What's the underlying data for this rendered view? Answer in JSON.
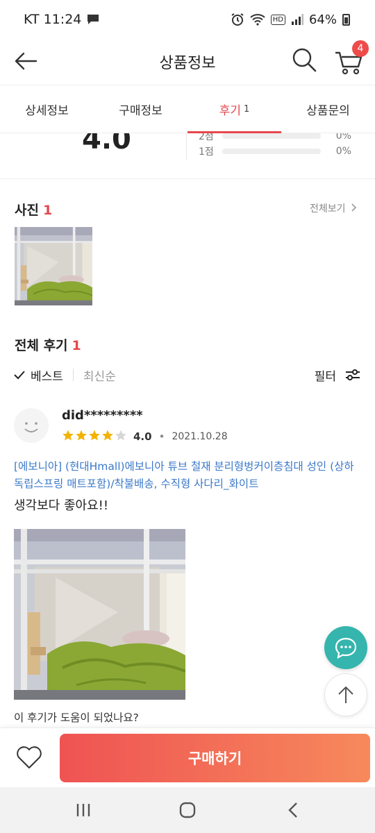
{
  "status_bar": {
    "carrier_time": "KT 11:24",
    "hd": "HD",
    "battery": "64%"
  },
  "header": {
    "title": "상품정보",
    "cart_count": "4"
  },
  "tabs": [
    {
      "label": "상세정보"
    },
    {
      "label": "구매정보"
    },
    {
      "label": "후기",
      "count": "1"
    },
    {
      "label": "상품문의"
    }
  ],
  "rating_summary": {
    "average": "4.0",
    "distribution": [
      {
        "label": "2점",
        "percent": "0%"
      },
      {
        "label": "1점",
        "percent": "0%"
      }
    ]
  },
  "photos_section": {
    "title": "사진",
    "count": "1",
    "see_all": "전체보기"
  },
  "reviews_section": {
    "title": "전체 후기",
    "count": "1"
  },
  "sort": {
    "best": "베스트",
    "latest": "최신순",
    "filter": "필터"
  },
  "review": {
    "user": "did*********",
    "rating": 4,
    "score": "4.0",
    "date": "2021.10.28",
    "product": "[에보니아] (현대Hmall)에보니아 튜브 철재 분리형벙커이층침대 성인 (상하 독립스프링 매트포함)/착불배송, 수직형 사다리_화이트",
    "text": "생각보다 좋아요!!",
    "helpful_question": "이 후기가 도움이 되었나요?"
  },
  "bottom": {
    "buy_label": "구매하기"
  },
  "colors": {
    "accent": "#e5484d",
    "link": "#3a78c9",
    "star": "#f2b300",
    "chat": "#35b5ad"
  }
}
